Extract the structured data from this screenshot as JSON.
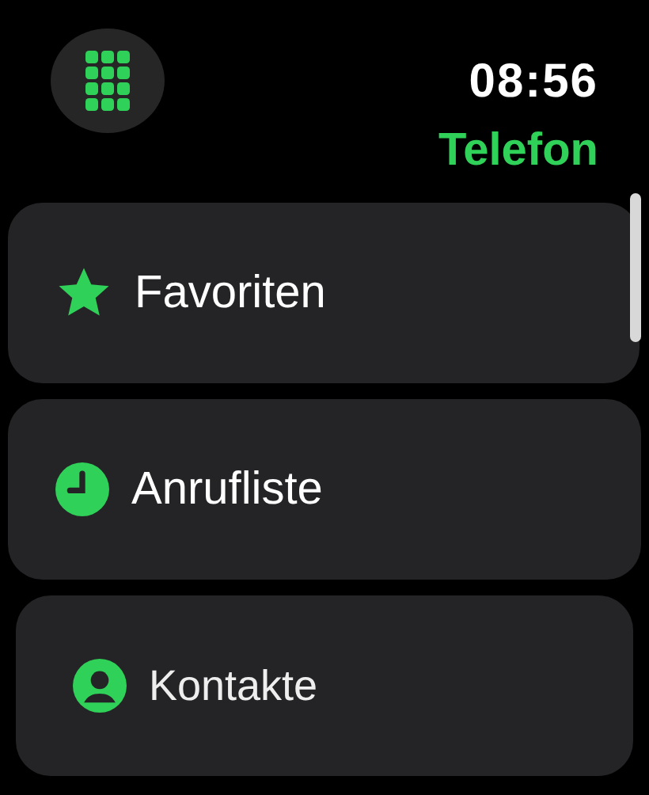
{
  "header": {
    "time": "08:56",
    "title": "Telefon"
  },
  "items": [
    {
      "label": "Favoriten",
      "kind": "star"
    },
    {
      "label": "Anrufliste",
      "kind": "clock"
    },
    {
      "label": "Kontakte",
      "kind": "person"
    }
  ]
}
